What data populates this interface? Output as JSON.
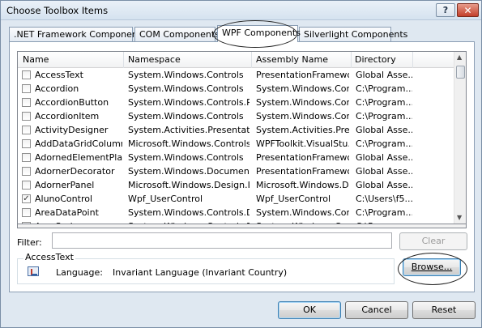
{
  "window": {
    "title": "Choose Toolbox Items",
    "help_glyph": "?",
    "close_glyph": "✕"
  },
  "tabs": [
    {
      "label": ".NET Framework Components"
    },
    {
      "label": "COM Components"
    },
    {
      "label": "WPF Components"
    },
    {
      "label": "Silverlight Components"
    }
  ],
  "active_tab": "WPF Components",
  "table": {
    "columns": [
      "Name",
      "Namespace",
      "Assembly Name",
      "Directory"
    ],
    "rows": [
      {
        "checked": false,
        "name": "AccessText",
        "namespace": "System.Windows.Controls",
        "assembly": "PresentationFramework",
        "directory": "Global Asse..."
      },
      {
        "checked": false,
        "name": "Accordion",
        "namespace": "System.Windows.Controls",
        "assembly": "System.Windows.Con...",
        "directory": "C:\\Program..."
      },
      {
        "checked": false,
        "name": "AccordionButton",
        "namespace": "System.Windows.Controls.Pr...",
        "assembly": "System.Windows.Con...",
        "directory": "C:\\Program..."
      },
      {
        "checked": false,
        "name": "AccordionItem",
        "namespace": "System.Windows.Controls",
        "assembly": "System.Windows.Con...",
        "directory": "C:\\Program..."
      },
      {
        "checked": false,
        "name": "ActivityDesigner",
        "namespace": "System.Activities.Presentation",
        "assembly": "System.Activities.Pres...",
        "directory": "Global Asse..."
      },
      {
        "checked": false,
        "name": "AddDataGridColumn...",
        "namespace": "Microsoft.Windows.Controls....",
        "assembly": "WPFToolkit.VisualStu...",
        "directory": "C:\\Program..."
      },
      {
        "checked": false,
        "name": "AdornedElementPlac...",
        "namespace": "System.Windows.Controls",
        "assembly": "PresentationFramework",
        "directory": "Global Asse..."
      },
      {
        "checked": false,
        "name": "AdornerDecorator",
        "namespace": "System.Windows.Documents",
        "assembly": "PresentationFramework",
        "directory": "Global Asse..."
      },
      {
        "checked": false,
        "name": "AdornerPanel",
        "namespace": "Microsoft.Windows.Design.I...",
        "assembly": "Microsoft.Windows.D...",
        "directory": "Global Asse..."
      },
      {
        "checked": true,
        "name": "AlunoControl",
        "namespace": "Wpf_UserControl",
        "assembly": "Wpf_UserControl",
        "directory": "C:\\Users\\f5..."
      },
      {
        "checked": false,
        "name": "AreaDataPoint",
        "namespace": "System.Windows.Controls.D...",
        "assembly": "System.Windows.Con...",
        "directory": "C:\\Program..."
      },
      {
        "checked": false,
        "name": "AreaSeries",
        "namespace": "System.Windows.Controls.D...",
        "assembly": "System.Windows.Con...",
        "directory": "C:\\Program..."
      }
    ]
  },
  "filter": {
    "label": "Filter:",
    "value": "",
    "clear_label": "Clear"
  },
  "info": {
    "title": "AccessText",
    "language_label": "Language:",
    "language_value": "Invariant Language (Invariant Country)"
  },
  "buttons": {
    "browse": "Browse...",
    "ok": "OK",
    "cancel": "Cancel",
    "reset": "Reset"
  },
  "icons": {
    "scroll_up": "up-arrow-icon",
    "scroll_down": "down-arrow-icon",
    "item_icon": "component-icon"
  }
}
